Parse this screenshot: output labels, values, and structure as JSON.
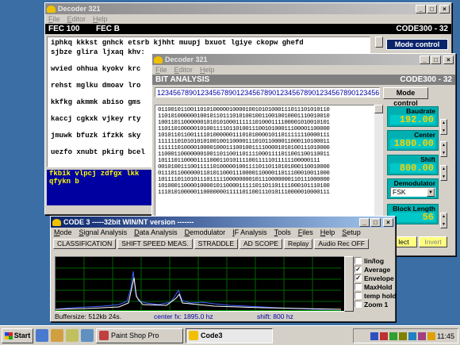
{
  "colors": {
    "desktop": "#3a6ea5",
    "accent": "#0a246a",
    "panel": "#00b0b0",
    "value": "#ffd000"
  },
  "decoder_back": {
    "title": "Decoder 321",
    "menu": [
      "File",
      "Editor",
      "Help"
    ],
    "header_left": "FEC 100",
    "header_mid": "FEC B",
    "header_right": "CODE300 - 32",
    "mode_button": "Mode control",
    "text_lines": [
      "iphkq kkkst gnhck etsrb kjhht muupj bxuot lgiye ckopw ghefd",
      "sjbze glira ljxaq khv:",
      "wvied ohhua kyokv krc",
      "rehst mglku dmoav lro",
      "kkfkg akmmk abiso gms",
      "kaccj cgkxk vjkey rty",
      "jmuwk bfuzk ifzkk sky",
      "uezfo xnubt pkirg bcel"
    ],
    "blue_lines": [
      "fkbik vlpcj zdfgx lkk",
      "qfykn b"
    ]
  },
  "decoder_front": {
    "title": "Decoder 321",
    "menu": [
      "File",
      "Editor",
      "Help"
    ],
    "header_left": "BIT ANALYSIS",
    "header_right": "CODE300 - 32",
    "digits": "12345678901234567890123456789012345678901234567890123456789",
    "mode_button": "Mode control",
    "bit_rows": [
      "01100101100110101000001000010010101000111011101010110",
      "11010100000010010110111010100100110010010001110010010",
      "10011011000000101010100011111101000111100001010010101",
      "11011010000010100111101101001110010100011100001100000",
      "10101101100111101000000111010100001011011111110000111",
      "11111101010101010010011000011101011000011000110100011",
      "11111101000010000100011100100111100001010100111010000",
      "11000110000000100110110011011110001111011001100110011",
      "10111011000011110001101011110011111011111100000111",
      "00101001110011111010000010011110110110101000110010000",
      "01110110000001101011000111000011000011011100010011000",
      "10111101101011101111100000000101110000000110111000000",
      "10100011000010000101100001111101101101111000101110100",
      "11101010000011000000011111011001110101110000010000111"
    ],
    "params": {
      "baudrate_label": "Baudrate",
      "baudrate_value": "192.00",
      "center_label": "Center",
      "center_value": "1800.00",
      "shift_label": "Shift",
      "shift_value": "800.00",
      "demodulator_label": "Demodulator",
      "demodulator_value": "FSK",
      "blocklength_label": "Block Length",
      "blocklength_value": "56"
    },
    "select_button": "lect",
    "invert_button": "Invert"
  },
  "code3": {
    "title": "CODE 3 -----32bit WIN/NT version -------",
    "menu": [
      "Mode",
      "Signal Analysis",
      "Data Analysis",
      "Demodulator",
      "IF Analysis",
      "Tools",
      "Files",
      "Help",
      "Setup"
    ],
    "toolbar": [
      "CLASSIFICATION",
      "SHIFT SPEED MEAS.",
      "STRADDLE",
      "AD SCOPE",
      "Replay",
      "Audio Rec OFF"
    ],
    "checks": [
      {
        "label": "lin/log",
        "checked": false
      },
      {
        "label": "Average",
        "checked": true
      },
      {
        "label": "Envelope",
        "checked": true
      },
      {
        "label": "MaxHold",
        "checked": false
      },
      {
        "label": "temp hold",
        "checked": false
      },
      {
        "label": "Zoom 1",
        "checked": false
      }
    ],
    "buffersize": "Buffersize: 512kb  24s.",
    "center_fx": "center fx:  1895.0 hz",
    "shift": "shift: 800 hz"
  },
  "taskbar": {
    "start": "Start",
    "tasks": [
      "Paint Shop Pro",
      "Code3"
    ],
    "clock": "11:45"
  }
}
